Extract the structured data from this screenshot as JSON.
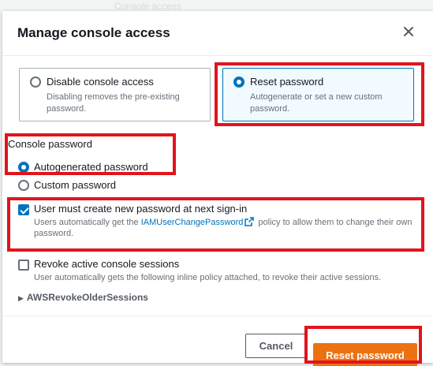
{
  "background": {
    "title": "Console access"
  },
  "modal": {
    "title": "Manage console access",
    "close_icon": "close-icon"
  },
  "access_options": [
    {
      "label": "Disable console access",
      "description": "Disabling removes the pre-existing password.",
      "selected": false
    },
    {
      "label": "Reset password",
      "description": "Autogenerate or set a new custom password.",
      "selected": true
    }
  ],
  "console_password": {
    "label": "Console password",
    "options": [
      {
        "label": "Autogenerated password",
        "selected": true
      },
      {
        "label": "Custom password",
        "selected": false
      }
    ]
  },
  "require_reset": {
    "label": "User must create new password at next sign-in",
    "checked": true,
    "desc_before": "Users automatically get the",
    "link": "IAMUserChangePassword",
    "desc_after": "policy to allow them to change their own password."
  },
  "revoke_sessions": {
    "label": "Revoke active console sessions",
    "checked": false,
    "description": "User automatically gets the following inline policy attached, to revoke their active sessions."
  },
  "policy_expander": {
    "label": "AWSRevokeOlderSessions",
    "icon": "caret-right-icon"
  },
  "footer": {
    "cancel": "Cancel",
    "submit": "Reset password"
  },
  "colors": {
    "accent": "#0073bb",
    "primary": "#ec7211",
    "highlight": "#e1141c"
  }
}
